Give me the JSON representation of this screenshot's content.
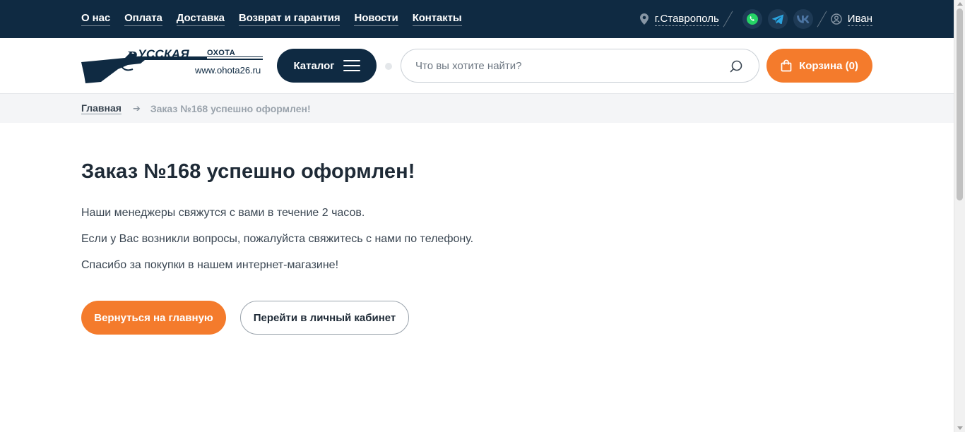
{
  "topnav": {
    "items": [
      {
        "label": "О нас"
      },
      {
        "label": "Оплата"
      },
      {
        "label": "Доставка"
      },
      {
        "label": "Возврат и гарантия"
      },
      {
        "label": "Новости"
      },
      {
        "label": "Контакты"
      }
    ]
  },
  "topright": {
    "city": "г.Ставрополь",
    "user": "Иван",
    "socials": [
      "whatsapp-icon",
      "telegram-icon",
      "vk-icon"
    ]
  },
  "logo": {
    "brand": "РУССКАЯ ОХОТА",
    "url": "www.ohota26.ru"
  },
  "header": {
    "catalog_label": "Каталог",
    "search_placeholder": "Что вы хотите найти?",
    "cart_label": "Корзина (0)"
  },
  "breadcrumbs": {
    "home": "Главная",
    "current": "Заказ №168 успешно оформлен!"
  },
  "main": {
    "title": "Заказ №168 успешно оформлен!",
    "paragraphs": [
      "Наши менеджеры свяжутся с вами в течение 2 часов.",
      "Если у Вас возникли вопросы, пожалуйста свяжитесь с нами по телефону.",
      "Спасибо за покупки в нашем интернет-магазине!"
    ],
    "primary_button": "Вернуться на главную",
    "secondary_button": "Перейти в личный кабинет"
  },
  "colors": {
    "navy": "#0f2a42",
    "accent": "#f47b2c",
    "whatsapp": "#25d366",
    "telegram": "#2aa3df",
    "vk": "#4c75a3"
  }
}
